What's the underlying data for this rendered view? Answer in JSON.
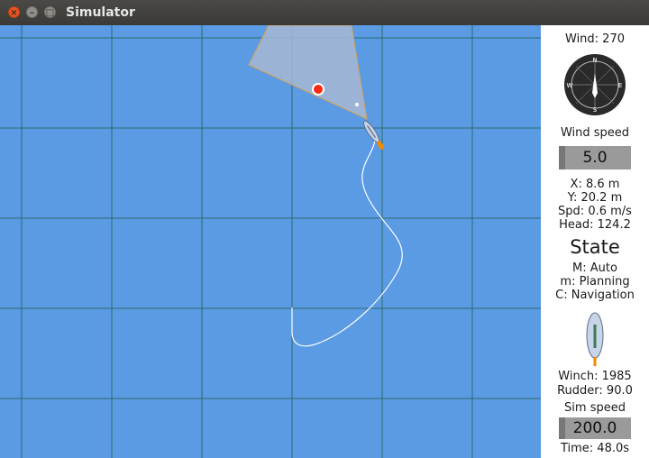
{
  "window": {
    "title": "Simulator",
    "close_glyph": "×",
    "minimize_glyph": "–",
    "maximize_glyph": "□"
  },
  "colors": {
    "sea": "#5b9be4",
    "grid": "#2f6a6a",
    "sector_fill": "#9eb5d6",
    "waypoint": "#ff2a10",
    "track": "#ffffff"
  },
  "map": {
    "icons": [
      "waypoint-marker",
      "boat-icon"
    ]
  },
  "panel": {
    "wind_label": "Wind: 270",
    "compass": {
      "n": "N",
      "e": "E",
      "s": "S",
      "w": "W"
    },
    "wind_speed_label": "Wind speed",
    "wind_speed_value": "5.0",
    "x_label": "X: 8.6 m",
    "y_label": "Y: 20.2 m",
    "spd_label": "Spd: 0.6 m/s",
    "head_label": "Head: 124.2",
    "state_title": "State",
    "mode_m": "M: Auto",
    "mode_m_small": "m: Planning",
    "mode_c": "C: Navigation",
    "winch_label": "Winch: 1985",
    "rudder_label": "Rudder: 90.0",
    "sim_speed_label": "Sim speed",
    "sim_speed_value": "200.0",
    "time_label": "Time: 48.0s"
  }
}
